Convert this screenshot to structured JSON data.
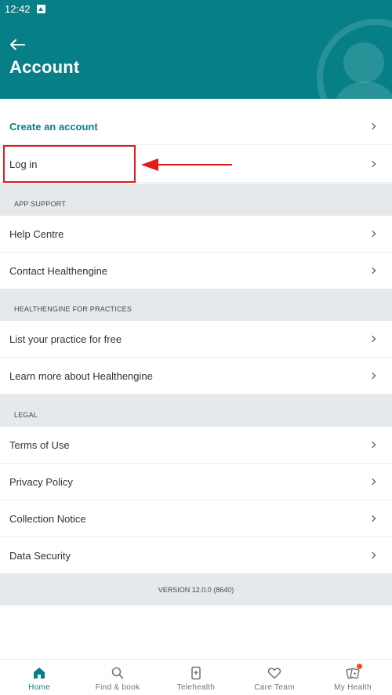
{
  "status_bar": {
    "time": "12:42",
    "notification_icon": "notification-icon"
  },
  "header": {
    "title": "Account",
    "back_icon": "back-arrow-icon",
    "background_color": "#067f87",
    "decoration_icon": "account-avatar-icon"
  },
  "account": {
    "create_account_label": "Create an account",
    "log_in_label": "Log in"
  },
  "app_support": {
    "heading": "APP SUPPORT",
    "items": [
      {
        "label": "Help Centre"
      },
      {
        "label": "Contact Healthengine"
      }
    ]
  },
  "practices": {
    "heading": "HEALTHENGINE FOR PRACTICES",
    "items": [
      {
        "label": "List your practice for free"
      },
      {
        "label": "Learn more about Healthengine"
      }
    ]
  },
  "legal": {
    "heading": "LEGAL",
    "items": [
      {
        "label": "Terms of Use"
      },
      {
        "label": "Privacy Policy"
      },
      {
        "label": "Collection Notice"
      },
      {
        "label": "Data Security"
      }
    ]
  },
  "version_label": "VERSION 12.0.0 (8640)",
  "annotation": {
    "highlight_color": "#e01b1b",
    "target": "Log in"
  },
  "bottom_nav": {
    "active": "Home",
    "items": [
      {
        "label": "Home",
        "icon": "home-icon"
      },
      {
        "label": "Find & book",
        "icon": "search-icon"
      },
      {
        "label": "Telehealth",
        "icon": "phone-icon"
      },
      {
        "label": "Care Team",
        "icon": "heart-icon"
      },
      {
        "label": "My Health",
        "icon": "health-cards-icon",
        "badge": "notification-dot"
      }
    ]
  },
  "colors": {
    "accent": "#067f87",
    "section_background": "#e6e9eb",
    "badge": "#e8531f"
  }
}
